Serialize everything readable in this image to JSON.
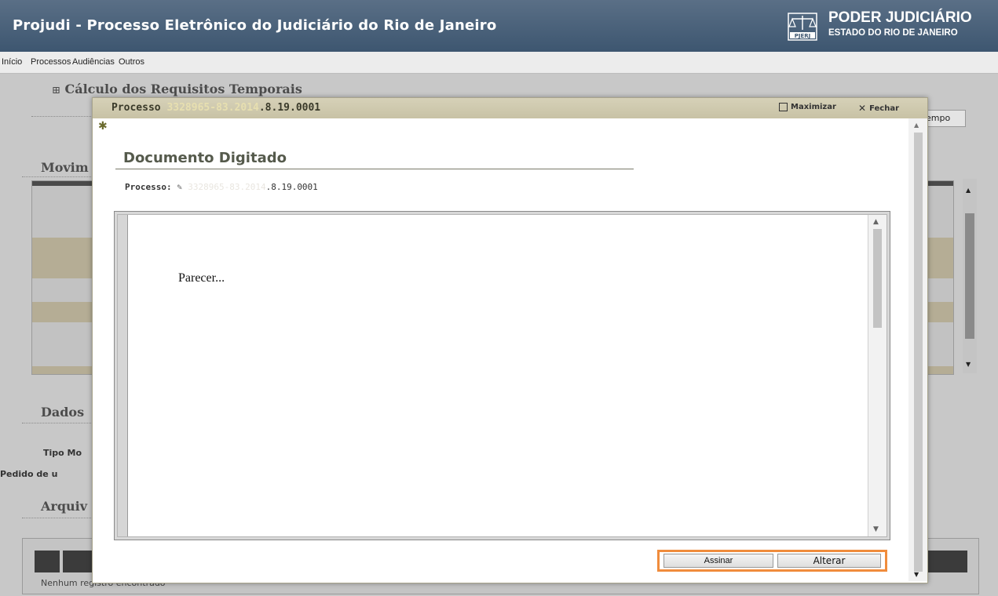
{
  "header": {
    "title": "Projudi - Processo Eletrônico do Judiciário do Rio de Janeiro",
    "brand_title": "PODER JUDICIÁRIO",
    "brand_subtitle": "ESTADO DO RIO DE JANEIRO",
    "logo_text": "PJERJ"
  },
  "menu": {
    "items": [
      "Início",
      "Processos",
      "Audiências",
      "Outros"
    ]
  },
  "background": {
    "calc_heading_icon": "⊞",
    "calc_heading": "Cálculo dos Requisitos Temporais",
    "tempo_button": "empo",
    "movim_heading": "Movim",
    "dados_heading": "Dados",
    "tipo_label": "Tipo Mo",
    "pedido_label": "Pedido de u",
    "arquiv_heading": "Arquiv",
    "no_records": "Nenhum registro encontrado"
  },
  "modal": {
    "title_prefix": "Processo ",
    "title_masked": "3328965-83.2014",
    "title_suffix": ".8.19.0001",
    "maximize_label": "Maximizar",
    "close_label": "Fechar",
    "close_glyph": "✕",
    "bug_glyph": "✱",
    "doc_heading": "Documento Digitado",
    "processo_label": "Processo:",
    "processo_masked": "3328965-83.2014",
    "processo_suffix": ".8.19.0001",
    "editor_text": "Parecer...",
    "sign_button": "Assinar",
    "edit_button": "Alterar"
  },
  "colors": {
    "header_bg": "#3d5670",
    "accent_orange": "#f08c3c",
    "modal_titlebar": "#cfc9ad"
  }
}
